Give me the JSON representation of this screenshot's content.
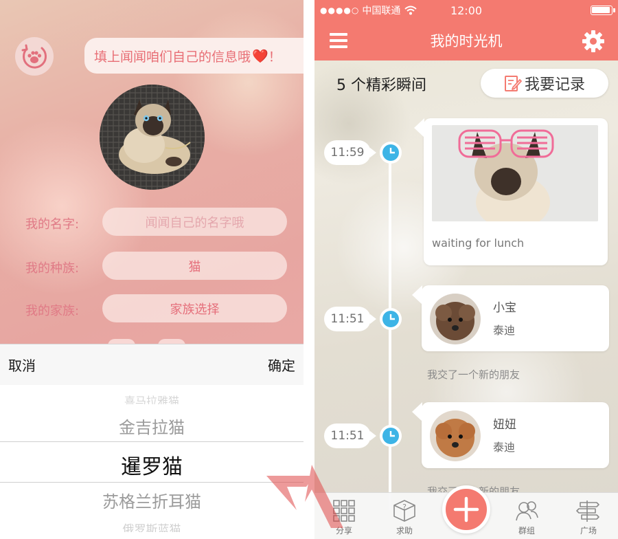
{
  "colors": {
    "brand_coral": "#f47a70",
    "label_pink": "#e07a86",
    "clock_blue": "#3db4e6"
  },
  "left": {
    "bubble_text": "填上闻闻咱们自己的信息哦",
    "bubble_trail": "！",
    "heart_icon": "heart-icon",
    "back_icon": "paw-icon",
    "form": {
      "name_label": "我的名字:",
      "name_placeholder": "闻闻自己的名字哦",
      "species_label": "我的种族:",
      "species_value": "猫",
      "family_label": "我的家族:",
      "family_value": "家族选择"
    },
    "picker": {
      "cancel": "取消",
      "confirm": "确定",
      "options": [
        "喜马拉雅猫",
        "金吉拉猫",
        "暹罗猫",
        "苏格兰折耳猫",
        "俄罗斯蓝猫"
      ],
      "selected": "暹罗猫"
    }
  },
  "right": {
    "status": {
      "carrier": "中国联通",
      "signal": "●●●●○",
      "time": "12:00"
    },
    "nav_title": "我的时光机",
    "moments_count": "5 个精彩瞬间",
    "record_button": "我要记录",
    "timeline": [
      {
        "time": "11:59",
        "caption": "waiting for lunch"
      },
      {
        "time": "11:51",
        "name": "小宝",
        "breed": "泰迪",
        "note": "我交了一个新的朋友"
      },
      {
        "time": "11:51",
        "name": "妞妞",
        "breed": "泰迪",
        "note": "我交了一个新的朋友"
      }
    ],
    "tabs": [
      {
        "label": "分享",
        "icon": "grid-icon"
      },
      {
        "label": "求助",
        "icon": "question-box-icon"
      },
      {
        "label": "群组",
        "icon": "group-icon"
      },
      {
        "label": "广场",
        "icon": "signpost-icon"
      }
    ],
    "add_icon": "plus-icon"
  }
}
